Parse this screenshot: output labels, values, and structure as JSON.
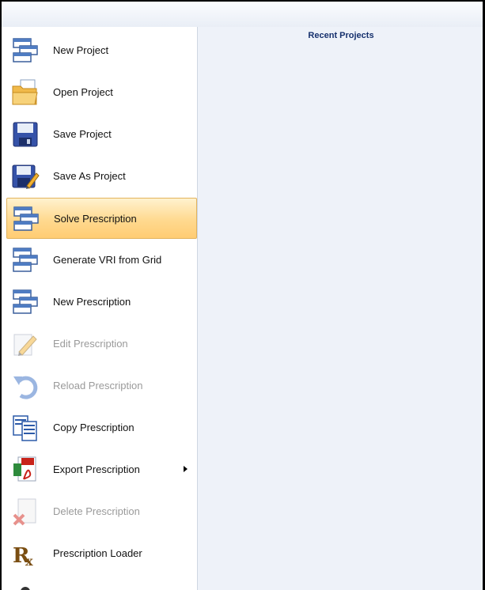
{
  "content": {
    "recent_title": "Recent Projects"
  },
  "menu": {
    "items": [
      {
        "label": "New Project",
        "icon": "new-project-icon",
        "enabled": true,
        "selected": false
      },
      {
        "label": "Open Project",
        "icon": "open-folder-icon",
        "enabled": true,
        "selected": false
      },
      {
        "label": "Save Project",
        "icon": "floppy-disk-icon",
        "enabled": true,
        "selected": false
      },
      {
        "label": "Save As Project",
        "icon": "save-as-icon",
        "enabled": true,
        "selected": false
      },
      {
        "label": "Solve Prescription",
        "icon": "solve-prescription-icon",
        "enabled": true,
        "selected": true
      },
      {
        "label": "Generate VRI from Grid",
        "icon": "generate-vri-icon",
        "enabled": true,
        "selected": false
      },
      {
        "label": "New Prescription",
        "icon": "new-prescription-icon",
        "enabled": true,
        "selected": false
      },
      {
        "label": "Edit Prescription",
        "icon": "edit-pencil-icon",
        "enabled": false,
        "selected": false
      },
      {
        "label": "Reload Prescription",
        "icon": "reload-arrow-icon",
        "enabled": false,
        "selected": false
      },
      {
        "label": "Copy Prescription",
        "icon": "copy-documents-icon",
        "enabled": true,
        "selected": false
      },
      {
        "label": "Export Prescription",
        "icon": "export-pdf-icon",
        "enabled": true,
        "selected": false,
        "has_submenu": true
      },
      {
        "label": "Delete Prescription",
        "icon": "delete-document-icon",
        "enabled": false,
        "selected": false
      },
      {
        "label": "Prescription Loader",
        "icon": "rx-icon",
        "enabled": true,
        "selected": false
      }
    ]
  },
  "colors": {
    "selection_highlight": "#ffd98f",
    "content_background": "#eef2f9",
    "recent_title": "#15306d"
  }
}
